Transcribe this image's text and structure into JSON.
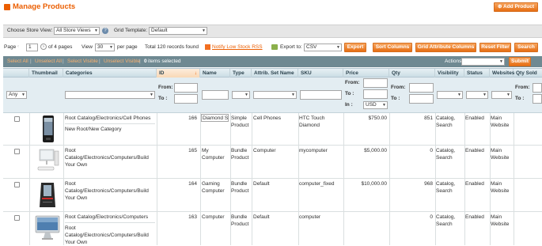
{
  "page": {
    "title": "Manage Products",
    "add_button": "Add Product"
  },
  "store": {
    "label": "Choose Store View:",
    "value": "All Store Views",
    "template_label": "Grid Template:",
    "template_value": "Default"
  },
  "pager": {
    "page_label": "Page",
    "page_value": "1",
    "of_pages": "of 4 pages",
    "view_label": "View",
    "per_page_value": "30",
    "per_page_label": "per page",
    "total": "Total 120 records found",
    "rss": "Notify Low Stock RSS",
    "export_label": "Export to:",
    "export_value": "CSV",
    "export_btn": "Export",
    "sort_btn": "Sort Columns",
    "attr_btn": "Grid Attribute Columns",
    "reset_btn": "Reset Filter",
    "search_btn": "Search"
  },
  "massaction": {
    "select_all": "Select All",
    "unselect_all": "Unselect All",
    "select_visible": "Select Visible",
    "unselect_visible": "Unselect Visible",
    "count": "0",
    "selected_text": "items selected",
    "actions_label": "Actions",
    "submit": "Submit"
  },
  "columns": {
    "thumbnail": "Thumbnail",
    "categories": "Categories",
    "id": "ID",
    "name": "Name",
    "type": "Type",
    "attr_set": "Attrib. Set Name",
    "sku": "SKU",
    "price": "Price",
    "qty": "Qty",
    "visibility": "Visibility",
    "status": "Status",
    "websites": "Websites",
    "qty_sold": "Qty Sold"
  },
  "filters": {
    "any": "Any",
    "from": "From:",
    "to": "To :",
    "in": "In :",
    "currency": "USD"
  },
  "rows": [
    {
      "cat1": "Root Catalog/Electronics/Cell Phones",
      "cat2": "New Root/New Category",
      "id": "166",
      "name": "Diamond S",
      "type": "Simple Product",
      "attr": "Cell Phones",
      "sku": "HTC Touch Diamond",
      "price": "$750.00",
      "qty": "851",
      "vis": "Catalog, Search",
      "status": "Enabled",
      "web": "Main Website"
    },
    {
      "cat1": "Root Catalog/Electronics/Computers/Build Your Own",
      "cat2": "",
      "id": "165",
      "name": "My Computer",
      "type": "Bundle Product",
      "attr": "Computer",
      "sku": "mycomputer",
      "price": "$5,000.00",
      "qty": "0",
      "vis": "Catalog, Search",
      "status": "Enabled",
      "web": "Main Website"
    },
    {
      "cat1": "Root Catalog/Electronics/Computers/Build Your Own",
      "cat2": "",
      "id": "164",
      "name": "Gaming Computer",
      "type": "Bundle Product",
      "attr": "Default",
      "sku": "computer_fixed",
      "price": "$10,000.00",
      "qty": "968",
      "vis": "Catalog, Search",
      "status": "Enabled",
      "web": "Main Website"
    },
    {
      "cat1": "Root Catalog/Electronics/Computers",
      "cat2": "Root Catalog/Electronics/Computers/Build Your Own",
      "id": "163",
      "name": "Computer",
      "type": "Bundle Product",
      "attr": "Default",
      "sku": "computer",
      "price": "",
      "qty": "0",
      "vis": "Catalog, Search",
      "status": "Enabled",
      "web": "Main Website"
    }
  ]
}
